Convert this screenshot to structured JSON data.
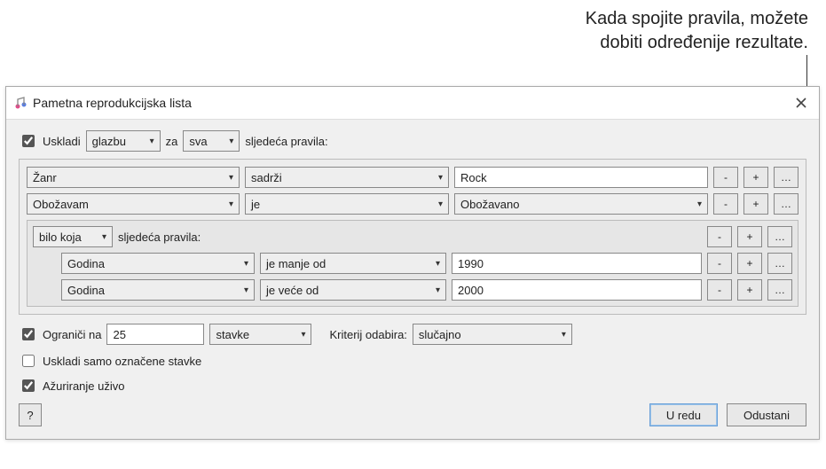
{
  "annotation": {
    "line1": "Kada spojite pravila, možete",
    "line2": "dobiti određenije rezultate."
  },
  "window": {
    "title": "Pametna reprodukcijska lista"
  },
  "match": {
    "checkbox_label": "Uskladi",
    "source": "glazbu",
    "za": "za",
    "scope": "sva",
    "suffix": "sljedeća pravila:"
  },
  "rules": [
    {
      "field": "Žanr",
      "op": "sadrži",
      "value": "Rock",
      "value_type": "text"
    },
    {
      "field": "Obožavam",
      "op": "je",
      "value": "Obožavano",
      "value_type": "select"
    }
  ],
  "nested": {
    "scope": "bilo koja",
    "suffix": "sljedeća pravila:",
    "rules": [
      {
        "field": "Godina",
        "op": "je manje od",
        "value": "1990"
      },
      {
        "field": "Godina",
        "op": "je veće od",
        "value": "2000"
      }
    ]
  },
  "limit": {
    "checkbox_label": "Ograniči na",
    "value": "25",
    "unit": "stavke",
    "criteria_label": "Kriterij odabira:",
    "criteria_value": "slučajno"
  },
  "options": {
    "only_checked": "Uskladi samo označene stavke",
    "live_update": "Ažuriranje uživo"
  },
  "buttons": {
    "help": "?",
    "ok": "U redu",
    "cancel": "Odustani",
    "minus": "-",
    "plus": "+",
    "more": "…"
  }
}
